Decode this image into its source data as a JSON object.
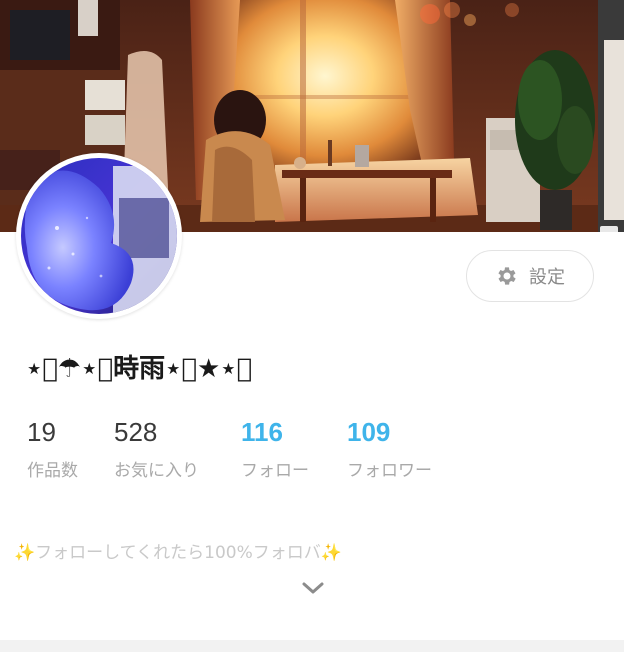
{
  "profile": {
    "username": "⋆͛☂︎⋆͛時雨⋆͛★⋆͛",
    "bio": {
      "sparkle_left": "✨",
      "text": "フォローしてくれたら100%フォロバ",
      "sparkle_right": "✨"
    }
  },
  "settings_button": {
    "label": "設定",
    "icon": "gear-icon"
  },
  "stats": {
    "works": {
      "value": "19",
      "label": "作品数"
    },
    "favorites": {
      "value": "528",
      "label": "お気に入り"
    },
    "following": {
      "value": "116",
      "label": "フォロー"
    },
    "followers": {
      "value": "109",
      "label": "フォロワー"
    }
  },
  "icons": {
    "expand": "chevron-down-icon"
  },
  "colors": {
    "accent": "#3fb4ea",
    "label_gray": "#a9a9a9",
    "bio_gray": "#c9c9c9",
    "sparkle": "#f3d76e"
  }
}
